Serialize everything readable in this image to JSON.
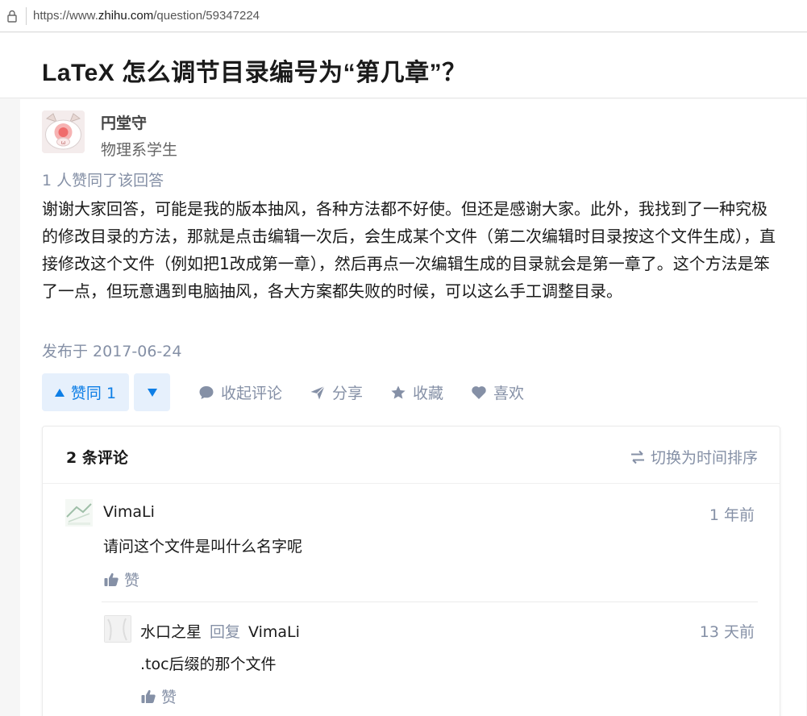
{
  "browser": {
    "url_prefix": "https://www.",
    "url_host": "zhihu.com",
    "url_path": "/question/59347224"
  },
  "question": {
    "title": "LaTeX 怎么调节目录编号为“第几章”？"
  },
  "answer": {
    "author_name": "円堂守",
    "author_bio": "物理系学生",
    "votes_line": "1 人赞同了该回答",
    "content": "谢谢大家回答，可能是我的版本抽风，各种方法都不好使。但还是感谢大家。此外，我找到了一种究极的修改目录的方法，那就是点击编辑一次后，会生成某个文件（第二次编辑时目录按这个文件生成），直接修改这个文件（例如把1改成第一章），然后再点一次编辑生成的目录就会是第一章了。这个方法是笨了一点，但玩意遇到电脑抽风，各大方案都失败的时候，可以这么手工调整目录。",
    "published": "发布于 2017-06-24"
  },
  "actions": {
    "upvote_label": "赞同 1",
    "collapse_comments": "收起评论",
    "share": "分享",
    "favorite": "收藏",
    "like": "喜欢"
  },
  "comments": {
    "count_label": "2 条评论",
    "sort_label": "切换为时间排序",
    "items": [
      {
        "author": "VimaLi",
        "time": "1 年前",
        "text": "请问这个文件是叫什么名字呢",
        "like_label": "赞"
      },
      {
        "author": "水口之星",
        "reply_word": "回复",
        "reply_to": "VimaLi",
        "time": "13 天前",
        "text": ".toc后缀的那个文件",
        "like_label": "赞"
      }
    ]
  },
  "colors": {
    "accent": "#0d7ee6",
    "muted": "#8590a6",
    "upvote_bg": "#e6f0fc"
  }
}
